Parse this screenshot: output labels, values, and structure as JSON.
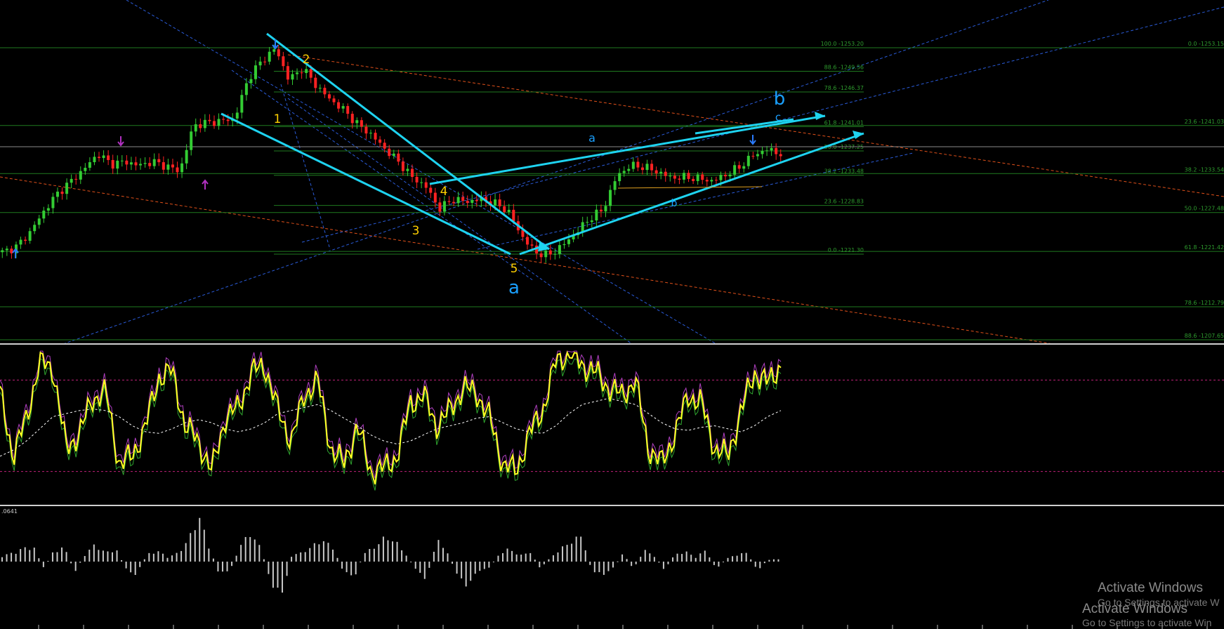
{
  "colors": {
    "background": "#000000",
    "fib_line": "#1f7a1f",
    "fib_text": "#2e9b2e",
    "up_candle": "#33cc33",
    "down_candle": "#ff2222",
    "channel": "#1ed3f0",
    "wave_label": "#ffd000",
    "wave_label_b": "#1aa0ff",
    "blue_dash": "#2a5bd8",
    "orange_dash": "#e0501a",
    "stoch_main": "#ffff22",
    "stoch_signal": "#ffffff",
    "osc_green": "#2fa52f",
    "osc_purple": "#b040c0",
    "level_line": "#c0207a",
    "histogram": "#c8c8c8",
    "arrow_blue": "#2a7bff",
    "arrow_purple": "#b030c0"
  },
  "chart_data": [
    {
      "type": "candlestick",
      "title": "",
      "fib_levels_left": [
        {
          "label": "100.0 -1253.20",
          "price": 1253.2
        },
        {
          "label": "88.6 -1249.56",
          "price": 1249.56
        },
        {
          "label": "78.6 -1246.37",
          "price": 1246.37
        },
        {
          "label": "61.8 -1241.01",
          "price": 1241.01
        },
        {
          "label": "50.0 -1237.25",
          "price": 1237.25
        },
        {
          "label": "38.2 -1233.48",
          "price": 1233.48
        },
        {
          "label": "23.6 -1228.83",
          "price": 1228.83
        },
        {
          "label": "0.0 -1221.30",
          "price": 1221.3
        }
      ],
      "fib_levels_right": [
        {
          "label": "0.0 -1253.15",
          "price": 1253.15
        },
        {
          "label": "23.6 -1241.03",
          "price": 1241.03
        },
        {
          "label": "38.2 -1233.54",
          "price": 1233.54
        },
        {
          "label": "50.0 -1227.48",
          "price": 1227.48
        },
        {
          "label": "61.8 -1221.42",
          "price": 1221.42
        },
        {
          "label": "78.6 -1212.79",
          "price": 1212.79
        },
        {
          "label": "88.6 -1207.65",
          "price": 1207.65
        }
      ],
      "wave_labels": [
        "1",
        "2",
        "3",
        "4",
        "5",
        "a",
        "a",
        "b",
        "c",
        "b"
      ],
      "price_path": [
        1221.6,
        1222.4,
        1224.6,
        1227.8,
        1230.6,
        1232.5,
        1234.5,
        1236.8,
        1235.2,
        1235.6,
        1235.0,
        1235.6,
        1234.9,
        1234.1,
        1241.2,
        1241.6,
        1241.9,
        1242.2,
        1248.4,
        1251.2,
        1253.1,
        1248.2,
        1250.1,
        1247.3,
        1245.2,
        1243.6,
        1241.4,
        1239.8,
        1237.6,
        1235.6,
        1233.2,
        1231.8,
        1228.3,
        1229.8,
        1229.4,
        1229.8,
        1229.2,
        1228.1,
        1224.2,
        1221.6,
        1221.1,
        1222.6,
        1224.6,
        1226.8,
        1228.2,
        1233.4,
        1235.0,
        1234.8,
        1234.0,
        1233.1,
        1233.2,
        1233.0,
        1232.6,
        1233.6,
        1234.8,
        1236.6,
        1237.5,
        1236.8
      ]
    },
    {
      "type": "line",
      "title": "",
      "series": [
        {
          "values": [
            72,
            30,
            55,
            92,
            88,
            35,
            45,
            68,
            72,
            25,
            30,
            50,
            82,
            86,
            50,
            40,
            20,
            55,
            62,
            85,
            90,
            60,
            40,
            70,
            80,
            35,
            25,
            50,
            20,
            22,
            30,
            65,
            70,
            50,
            60,
            75,
            72,
            55,
            25,
            20,
            45,
            60,
            92,
            98,
            90,
            85,
            75,
            70,
            80,
            35,
            25,
            45,
            70,
            65,
            35,
            30,
            60,
            85,
            78,
            90
          ]
        },
        {
          "values": [
            30,
            34,
            40,
            48,
            56,
            58,
            60,
            61,
            60,
            56,
            50,
            46,
            45,
            48,
            52,
            54,
            52,
            48,
            46,
            48,
            52,
            58,
            60,
            62,
            64,
            60,
            55,
            50,
            44,
            40,
            38,
            40,
            44,
            48,
            50,
            52,
            55,
            56,
            52,
            48,
            46,
            45,
            50,
            58,
            64,
            66,
            68,
            66,
            64,
            58,
            52,
            48,
            47,
            49,
            50,
            48,
            46,
            50,
            56,
            60
          ]
        }
      ],
      "levels": [
        80,
        20
      ]
    },
    {
      "type": "bar",
      "title": "",
      "ylabel": ".0641",
      "values": [
        0.008,
        0.012,
        0.018,
        0.022,
        -0.01,
        0.015,
        0.02,
        -0.015,
        0.01,
        0.024,
        0.012,
        0.018,
        -0.012,
        -0.018,
        0.01,
        0.015,
        0.006,
        0.012,
        0.03,
        0.064,
        0.02,
        -0.018,
        -0.012,
        0.022,
        0.04,
        0.018,
        -0.03,
        -0.048,
        0.01,
        0.012,
        0.022,
        0.03,
        0.018,
        -0.014,
        -0.022,
        0.012,
        0.02,
        0.034,
        0.028,
        0.01,
        -0.012,
        -0.024,
        0.03,
        0.014,
        -0.02,
        -0.034,
        -0.012,
        -0.01,
        0.01,
        0.018,
        0.008,
        0.014,
        -0.01,
        0.006,
        0.018,
        0.028,
        0.036,
        -0.014,
        -0.018,
        -0.01,
        0.012,
        -0.01,
        0.016,
        0.008,
        -0.012,
        0.01,
        0.014,
        0.006,
        0.016,
        -0.01,
        0.004,
        0.01,
        0.012,
        -0.012,
        0.002,
        0.004
      ]
    }
  ],
  "watermark": {
    "line1": "Activate Windows",
    "line2": "Go to Settings to activate W",
    "line3": "Activate Windows",
    "line4": "Go to Settings to activate Win"
  }
}
